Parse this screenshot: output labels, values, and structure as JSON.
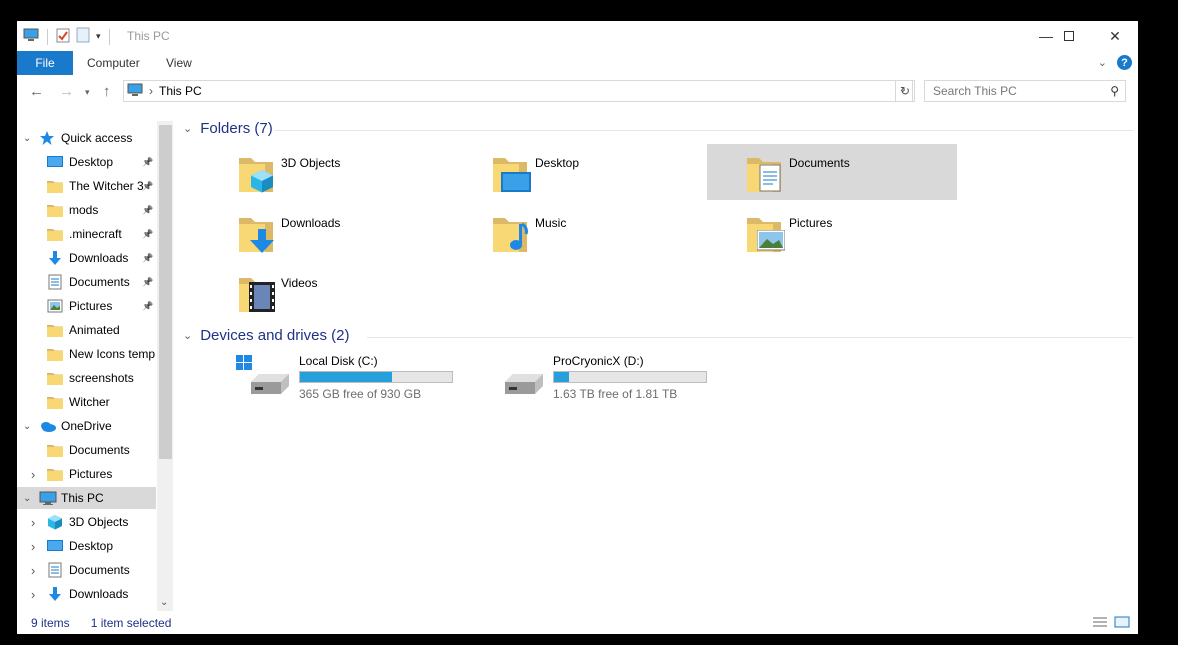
{
  "window": {
    "title": "This PC"
  },
  "ribbon": {
    "tabs": [
      "File",
      "Computer",
      "View"
    ]
  },
  "address": {
    "crumb": "This PC"
  },
  "search": {
    "placeholder": "Search This PC"
  },
  "sidebar": {
    "items": [
      {
        "label": "Quick access",
        "level": 0,
        "expanded": true,
        "icon": "star-icon"
      },
      {
        "label": "Desktop",
        "level": 1,
        "pinned": true,
        "icon": "desktop-icon"
      },
      {
        "label": "The Witcher 3",
        "level": 1,
        "pinned": true,
        "icon": "folder-icon"
      },
      {
        "label": "mods",
        "level": 1,
        "pinned": true,
        "icon": "folder-icon"
      },
      {
        "label": ".minecraft",
        "level": 1,
        "pinned": true,
        "icon": "folder-icon"
      },
      {
        "label": "Downloads",
        "level": 1,
        "pinned": true,
        "icon": "download-icon"
      },
      {
        "label": "Documents",
        "level": 1,
        "pinned": true,
        "icon": "documents-icon"
      },
      {
        "label": "Pictures",
        "level": 1,
        "pinned": true,
        "icon": "pictures-icon"
      },
      {
        "label": "Animated",
        "level": 1,
        "icon": "folder-icon"
      },
      {
        "label": "New Icons temp",
        "level": 1,
        "icon": "folder-icon"
      },
      {
        "label": "screenshots",
        "level": 1,
        "icon": "folder-icon"
      },
      {
        "label": "Witcher",
        "level": 1,
        "icon": "folder-icon"
      },
      {
        "label": "OneDrive",
        "level": 0,
        "expanded": true,
        "icon": "onedrive-icon"
      },
      {
        "label": "Documents",
        "level": 1,
        "icon": "folder-icon"
      },
      {
        "label": "Pictures",
        "level": 1,
        "collapsed": true,
        "icon": "folder-icon"
      },
      {
        "label": "This PC",
        "level": 0,
        "expanded": true,
        "selected": true,
        "icon": "pc-icon"
      },
      {
        "label": "3D Objects",
        "level": 1,
        "collapsed": true,
        "icon": "cube-icon"
      },
      {
        "label": "Desktop",
        "level": 1,
        "collapsed": true,
        "icon": "desktop-icon"
      },
      {
        "label": "Documents",
        "level": 1,
        "collapsed": true,
        "icon": "documents-icon"
      },
      {
        "label": "Downloads",
        "level": 1,
        "collapsed": true,
        "icon": "download-icon"
      }
    ]
  },
  "folders": {
    "heading": "Folders (7)",
    "items": [
      {
        "label": "3D Objects",
        "icon": "3d-objects-folder-icon"
      },
      {
        "label": "Desktop",
        "icon": "desktop-folder-icon"
      },
      {
        "label": "Documents",
        "icon": "documents-folder-icon",
        "selected": true
      },
      {
        "label": "Downloads",
        "icon": "downloads-folder-icon"
      },
      {
        "label": "Music",
        "icon": "music-folder-icon"
      },
      {
        "label": "Pictures",
        "icon": "pictures-folder-icon"
      },
      {
        "label": "Videos",
        "icon": "videos-folder-icon"
      }
    ]
  },
  "drives": {
    "heading": "Devices and drives (2)",
    "items": [
      {
        "label": "Local Disk (C:)",
        "free": "365 GB free of 930 GB",
        "used_fraction": 0.608,
        "icon": "windows-drive-icon"
      },
      {
        "label": "ProCryonicX (D:)",
        "free": "1.63 TB free of 1.81 TB",
        "used_fraction": 0.1,
        "icon": "hard-drive-icon"
      }
    ]
  },
  "status": {
    "count": "9 items",
    "selected": "1 item selected"
  },
  "colors": {
    "accent": "#1979ca",
    "heading": "#1e3287",
    "bar": "#26a0da",
    "selection": "#d9d9d9"
  }
}
